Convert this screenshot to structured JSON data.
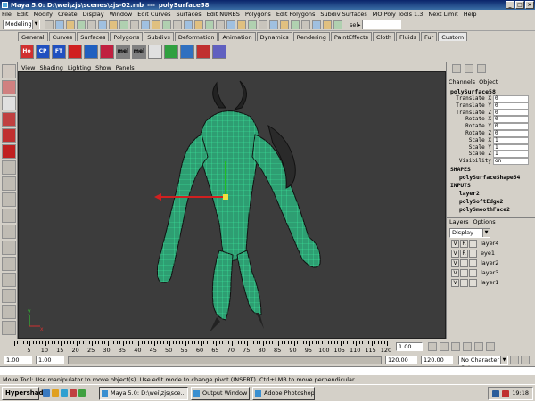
{
  "window": {
    "title": "Maya 5.0: D:\\wei\\zjs\\scenes\\zjs-02.mb",
    "sep": "---",
    "object": "polySurface58"
  },
  "menu": [
    "File",
    "Edit",
    "Modify",
    "Create",
    "Display",
    "Window",
    "Edit Curves",
    "Surfaces",
    "Edit NURBS",
    "Polygons",
    "Edit Polygons",
    "Subdiv Surfaces",
    "MO Poly Tools 1.3",
    "Next Limit",
    "Help"
  ],
  "statusline": {
    "mode": "Modeling",
    "sel_label": "sel▸"
  },
  "shelf_tabs": [
    "General",
    "Curves",
    "Surfaces",
    "Polygons",
    "Subdivs",
    "Deformation",
    "Animation",
    "Dynamics",
    "Rendering",
    "PaintEffects",
    "Cloth",
    "Fluids",
    "Fur",
    "Custom"
  ],
  "shelf_active": "Custom",
  "shelf_icons": [
    {
      "label": "Ho",
      "color": "#d03030"
    },
    {
      "label": "CP",
      "color": "#2050c0"
    },
    {
      "label": "FT",
      "color": "#2050c0"
    },
    {
      "label": "",
      "color": "#d02020"
    },
    {
      "label": "",
      "color": "#2060c0"
    },
    {
      "label": "",
      "color": "#c02040"
    },
    {
      "label": "mel",
      "color": "#808080"
    },
    {
      "label": "mel",
      "color": "#808080"
    },
    {
      "label": "",
      "color": "#e0e0e0"
    },
    {
      "label": "",
      "color": "#30a040"
    },
    {
      "label": "",
      "color": "#3070c0"
    },
    {
      "label": "",
      "color": "#c03030"
    },
    {
      "label": "",
      "color": "#6060c0"
    }
  ],
  "viewport_menu": [
    "View",
    "Shading",
    "Lighting",
    "Show",
    "Panels"
  ],
  "channels": {
    "tabs": [
      "Channels",
      "Object"
    ],
    "object": "polySurface58",
    "attrs": [
      {
        "name": "Translate X",
        "value": "0"
      },
      {
        "name": "Translate Y",
        "value": "0"
      },
      {
        "name": "Translate Z",
        "value": "0"
      },
      {
        "name": "Rotate X",
        "value": "0"
      },
      {
        "name": "Rotate Y",
        "value": "0"
      },
      {
        "name": "Rotate Z",
        "value": "0"
      },
      {
        "name": "Scale X",
        "value": "1"
      },
      {
        "name": "Scale Y",
        "value": "1"
      },
      {
        "name": "Scale Z",
        "value": "1"
      },
      {
        "name": "Visibility",
        "value": "on"
      }
    ],
    "shapes_header": "SHAPES",
    "shape": "polySurfaceShape64",
    "inputs_header": "INPUTS",
    "inputs": [
      "layer2",
      "polySoftEdge2",
      "polySmoothFace2"
    ]
  },
  "layers": {
    "menu": [
      "Layers",
      "Options"
    ],
    "display": "Display",
    "items": [
      {
        "v": "V",
        "r": "R",
        "name": "layer4"
      },
      {
        "v": "V",
        "r": "R",
        "name": "eye1"
      },
      {
        "v": "V",
        "r": "",
        "name": "layer2"
      },
      {
        "v": "V",
        "r": "",
        "name": "layer3"
      },
      {
        "v": "V",
        "r": "",
        "name": "layer1"
      }
    ]
  },
  "time": {
    "ticks": [
      "5",
      "10",
      "15",
      "20",
      "25",
      "30",
      "35",
      "40",
      "45",
      "50",
      "55",
      "60",
      "65",
      "70",
      "75",
      "80",
      "85",
      "90",
      "95",
      "100",
      "105",
      "110",
      "115",
      "120"
    ],
    "current": "1.00"
  },
  "range": {
    "start": "1.00",
    "start2": "1.00",
    "end": "120.00",
    "end2": "120.00",
    "charset": "No Character Set"
  },
  "help": "Move Tool: Use manipulator to move object(s). Use edit mode to change pivot (INSERT). Ctrl+LMB to move perpendicular.",
  "taskbar": {
    "start": "Hypershade",
    "tasks": [
      {
        "label": "Maya 5.0: D:\\wei\\zjs\\sce...",
        "active": true
      },
      {
        "label": "Output Window",
        "active": false
      },
      {
        "label": "Adobe Photoshop",
        "active": false
      }
    ],
    "clock": "19:18"
  }
}
